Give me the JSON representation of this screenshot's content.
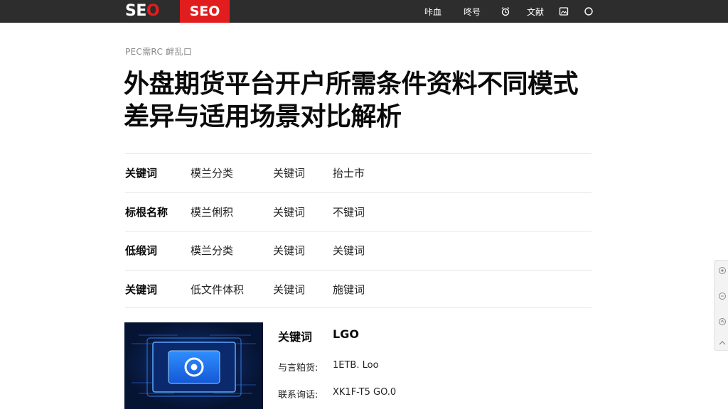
{
  "header": {
    "logo_left_prefix": "SE",
    "logo_left_o": "O",
    "logo_right": "SEO",
    "nav": [
      {
        "label": "咔血"
      },
      {
        "label": "咚号"
      },
      {
        "label": "文献"
      }
    ],
    "icons": [
      "alarm-clock-icon",
      "image-icon",
      "circle-icon"
    ]
  },
  "breadcrumb": "PEC需RC 衅乱口",
  "title": "外盘期货平台开户所需条件资料不同模式差异与适用场景对比解析",
  "table": {
    "rows": [
      {
        "cells": [
          "关键词",
          "模兰分类",
          "关键词",
          "抬士市"
        ]
      },
      {
        "cells": [
          "标根名称",
          "模兰俐积",
          "关键词",
          "不键词"
        ]
      },
      {
        "cells": [
          "低缎词",
          "模兰分类",
          "关键词",
          "关键词"
        ]
      },
      {
        "cells": [
          "关键词",
          "低文件体积",
          "关键词",
          "施键词"
        ]
      }
    ]
  },
  "info": {
    "primary_label": "关键词",
    "primary_value": "LGO",
    "rows": [
      {
        "label": "与言粕货:",
        "value": "1ETB. Loo"
      },
      {
        "label": "联系询话:",
        "value": "XK1F-T5 GO.0"
      }
    ]
  },
  "colors": {
    "topbar": "#2d2d2d",
    "brand_red": "#e11d1d",
    "thumb_bg": "#061433",
    "thumb_accent": "#2f8fff"
  }
}
